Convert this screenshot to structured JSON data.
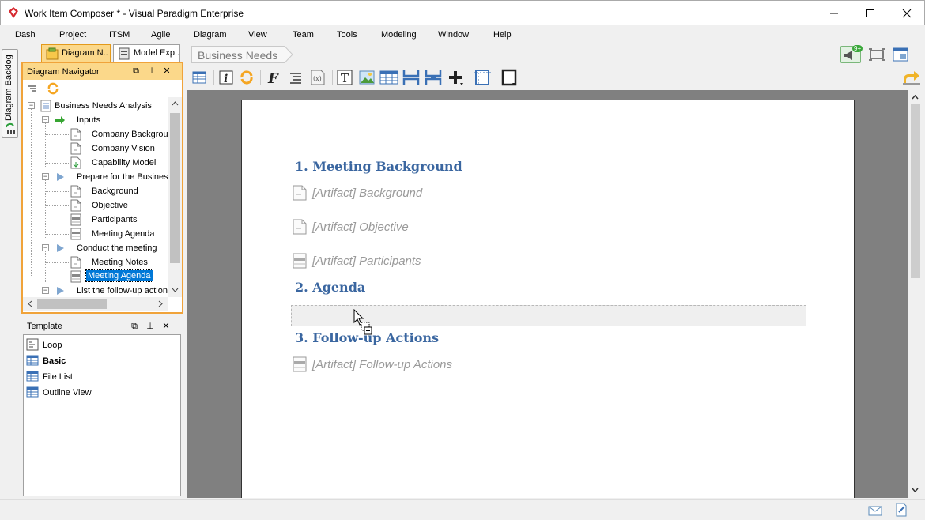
{
  "window": {
    "title": "Work Item Composer * - Visual Paradigm Enterprise",
    "icons": {
      "app": "vp-diamond-icon",
      "minimize": "minimize-icon",
      "maximize": "maximize-icon",
      "close": "close-icon"
    }
  },
  "menu": [
    "Dash",
    "Project",
    "ITSM",
    "Agile",
    "Diagram",
    "View",
    "Team",
    "Tools",
    "Modeling",
    "Window",
    "Help"
  ],
  "side_strip": {
    "backlog_label": "Diagram Backlog"
  },
  "panel_tabs": [
    {
      "label": "Diagram N...",
      "icon": "diagram-navigator-icon",
      "active": true
    },
    {
      "label": "Model Exp...",
      "icon": "model-explorer-icon",
      "active": false
    }
  ],
  "navigator": {
    "title": "Diagram Navigator",
    "root": "Business Needs Analysis",
    "groups": [
      {
        "label": "Inputs",
        "icon": "arrow-right-green-icon",
        "items": [
          {
            "label": "Company Background",
            "icon": "document-icon"
          },
          {
            "label": "Company Vision",
            "icon": "document-icon"
          },
          {
            "label": "Capability Model",
            "icon": "document-download-icon"
          }
        ]
      },
      {
        "label": "Prepare for the Business Needs",
        "icon": "play-triangle-icon",
        "items": [
          {
            "label": "Background",
            "icon": "document-icon"
          },
          {
            "label": "Objective",
            "icon": "document-icon"
          },
          {
            "label": "Participants",
            "icon": "table-document-icon"
          },
          {
            "label": "Meeting Agenda",
            "icon": "table-document-icon"
          }
        ]
      },
      {
        "label": "Conduct the meeting",
        "icon": "play-triangle-icon",
        "items": [
          {
            "label": "Meeting Notes",
            "icon": "document-icon"
          },
          {
            "label": "Meeting Agenda",
            "icon": "table-document-icon",
            "selected": true
          }
        ]
      },
      {
        "label": "List the follow-up actions",
        "icon": "play-triangle-icon",
        "items": []
      }
    ]
  },
  "template_panel": {
    "title": "Template",
    "items": [
      {
        "label": "Loop",
        "icon": "loop-icon",
        "bold": false
      },
      {
        "label": "Basic",
        "icon": "grid-table-icon",
        "bold": true
      },
      {
        "label": "File List",
        "icon": "grid-table-icon",
        "bold": false
      },
      {
        "label": "Outline View",
        "icon": "grid-table-icon",
        "bold": false
      }
    ]
  },
  "breadcrumb": "Business Needs",
  "badge_count": "9+",
  "document": {
    "sections": [
      {
        "heading": "1. Meeting Background",
        "artifacts": [
          {
            "label": "[Artifact] Background",
            "icon": "document-icon"
          },
          {
            "label": "[Artifact] Objective",
            "icon": "document-icon"
          },
          {
            "label": "[Artifact] Participants",
            "icon": "table-document-icon"
          }
        ]
      },
      {
        "heading": "2. Agenda",
        "artifacts": []
      },
      {
        "heading": "3. Follow-up Actions",
        "artifacts": [
          {
            "label": "[Artifact] Follow-up Actions",
            "icon": "table-document-icon"
          }
        ]
      }
    ]
  },
  "colors": {
    "accent_orange": "#f0a33a",
    "heading_blue": "#3a66a0",
    "selection": "#0078d7"
  }
}
